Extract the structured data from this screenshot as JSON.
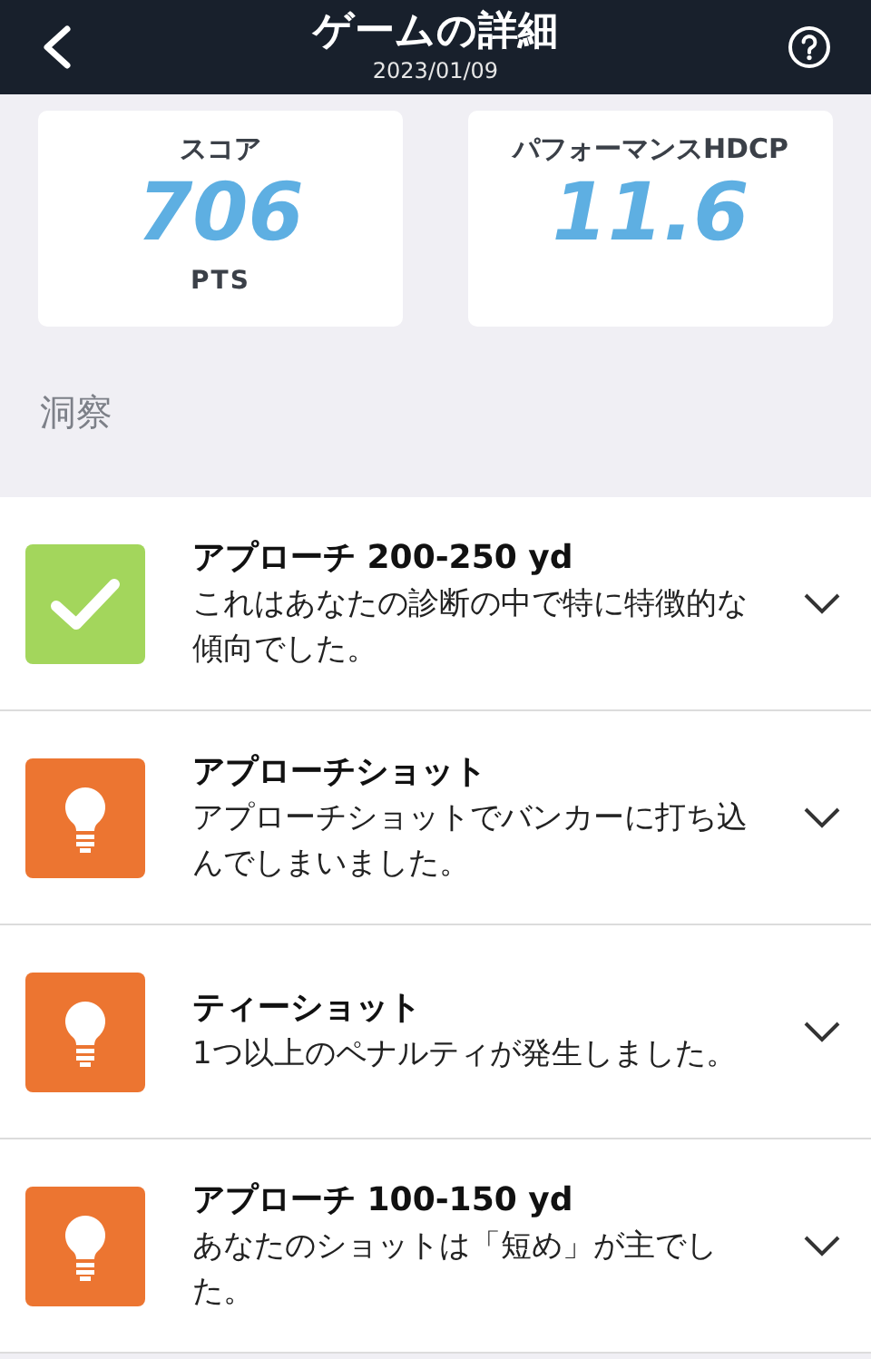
{
  "header": {
    "title": "ゲームの詳細",
    "date": "2023/01/09"
  },
  "stats": [
    {
      "label": "スコア",
      "value": "706",
      "unit": "PTS"
    },
    {
      "label": "パフォーマンスHDCP",
      "value": "11.6"
    }
  ],
  "section_title": "洞察",
  "insights": [
    {
      "kind": "check",
      "title": "アプローチ 200-250 yd",
      "text": "これはあなたの診断の中で特に特徴的な傾向でした。",
      "expanded": false
    },
    {
      "kind": "tip",
      "title": "アプローチショット",
      "text": "アプローチショットでバンカーに打ち込んでしまいました。",
      "expanded": false
    },
    {
      "kind": "tip",
      "title": "ティーショット",
      "text": "1つ以上のペナルティが発生しました。",
      "expanded": false
    },
    {
      "kind": "tip",
      "title": "アプローチ 100-150 yd",
      "text": "あなたのショットは「短め」が主でした。",
      "expanded": false
    }
  ]
}
